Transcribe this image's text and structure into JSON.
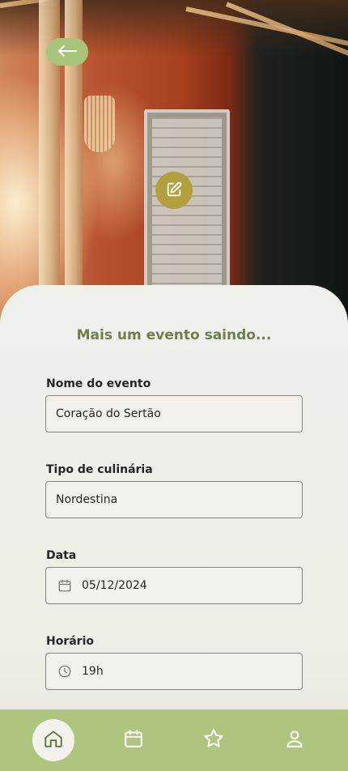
{
  "header": {
    "back_icon": "arrow-left-icon",
    "edit_icon": "edit-pencil-icon"
  },
  "form": {
    "title": "Mais um evento saindo...",
    "fields": [
      {
        "label": "Nome do evento",
        "value": "Coração do Sertão"
      },
      {
        "label": "Tipo de culinária",
        "value": "Nordestina"
      },
      {
        "label": "Data",
        "value": "05/12/2024",
        "icon": "calendar-icon"
      },
      {
        "label": "Horário",
        "value": "19h",
        "icon": "clock-icon"
      }
    ]
  },
  "bottom_nav": {
    "items": [
      {
        "icon": "home-icon",
        "active": true
      },
      {
        "icon": "calendar-icon",
        "active": false
      },
      {
        "icon": "star-icon",
        "active": false
      },
      {
        "icon": "user-icon",
        "active": false
      }
    ]
  },
  "colors": {
    "accent_green": "#aec57f",
    "back_button": "#a7c47a",
    "edit_button": "#b2a03e",
    "title_text": "#6f7f4c",
    "nav_active_bg": "#f1f2ea"
  }
}
